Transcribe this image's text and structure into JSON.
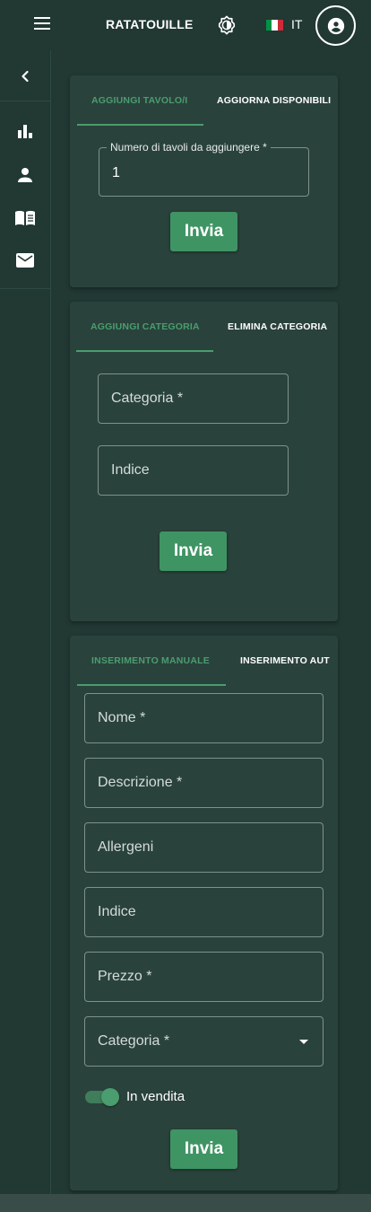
{
  "appbar": {
    "title": "RATATOUILLE",
    "language": "IT",
    "flag_colors": [
      "#009246",
      "#ffffff",
      "#ce2b37"
    ]
  },
  "rail": {
    "items": [
      {
        "icon": "chevron-left-icon"
      },
      {
        "icon": "bar-chart-icon"
      },
      {
        "icon": "person-icon"
      },
      {
        "icon": "menu-book-icon"
      },
      {
        "icon": "mail-icon"
      }
    ]
  },
  "tables_card": {
    "tabs": [
      "AGGIUNGI TAVOLO/I",
      "AGGIORNA DISPONIBILI"
    ],
    "field_label": "Numero di tavoli da aggiungere *",
    "field_value": "1",
    "submit": "Invia"
  },
  "category_card": {
    "tabs": [
      "AGGIUNGI CATEGORIA",
      "ELIMINA CATEGORIA"
    ],
    "fields": [
      "Categoria *",
      "Indice"
    ],
    "submit": "Invia"
  },
  "product_card": {
    "tabs": [
      "INSERIMENTO MANUALE",
      "INSERIMENTO AUT"
    ],
    "fields": [
      "Nome *",
      "Descrizione *",
      "Allergeni",
      "Indice",
      "Prezzo *"
    ],
    "select_label": "Categoria *",
    "toggle_label": "In vendita",
    "toggle_on": true,
    "submit": "Invia"
  },
  "colors": {
    "background": "#213833",
    "card": "#2a423c",
    "accent": "#4a9d6f",
    "button": "#3f9464"
  }
}
